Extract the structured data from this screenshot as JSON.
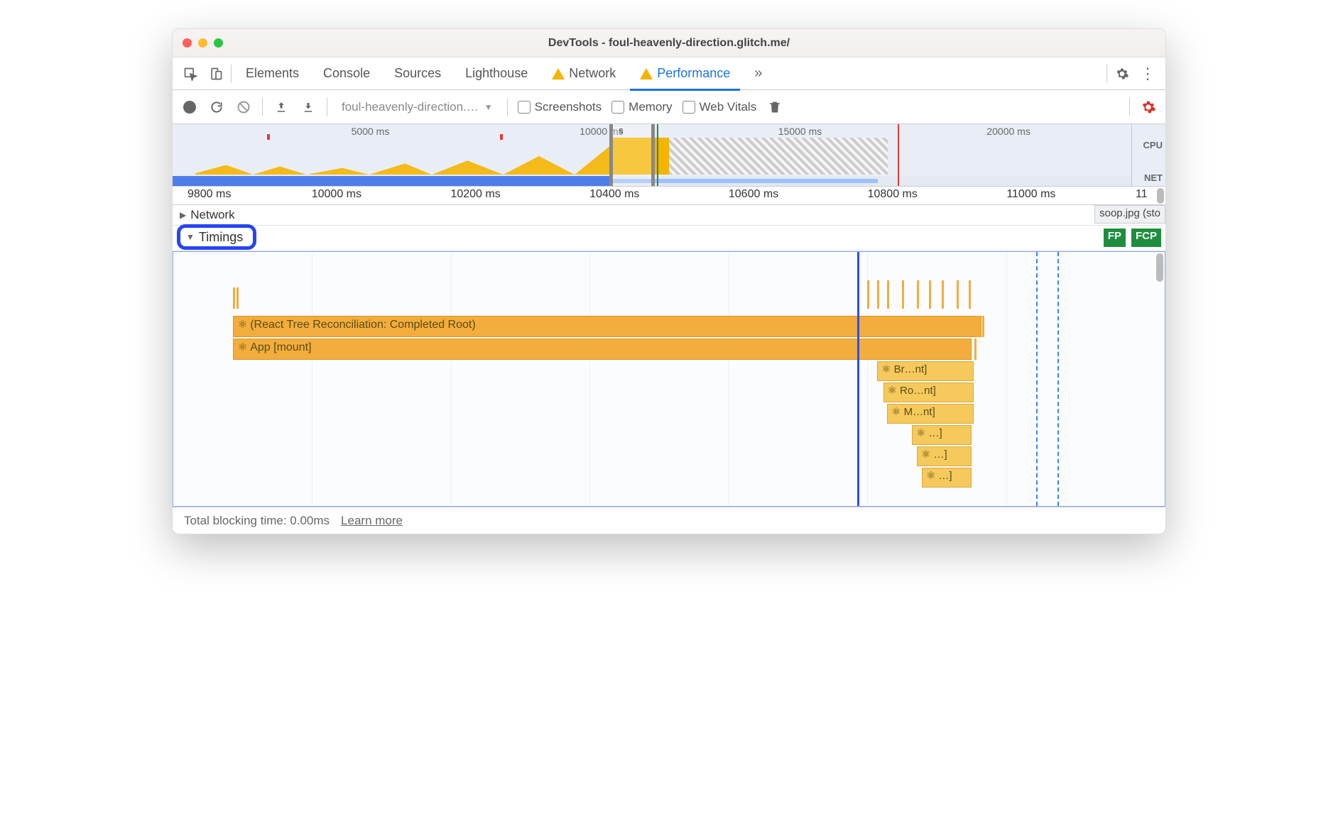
{
  "window": {
    "title": "DevTools - foul-heavenly-direction.glitch.me/"
  },
  "tabs": {
    "items": [
      "Elements",
      "Console",
      "Sources",
      "Lighthouse",
      "Network",
      "Performance"
    ],
    "active_index": 5,
    "warn_indexes": [
      4,
      5
    ]
  },
  "toolbar": {
    "profile_select": "foul-heavenly-direction.…",
    "checks": {
      "screenshots": "Screenshots",
      "memory": "Memory",
      "webvitals": "Web Vitals"
    }
  },
  "overview": {
    "ticks": [
      "5000 ms",
      "10000 ms",
      "15000 ms",
      "20000 ms"
    ],
    "labels": {
      "cpu": "CPU",
      "net": "NET"
    }
  },
  "ruler": {
    "ticks": [
      "9800 ms",
      "10000 ms",
      "10200 ms",
      "10400 ms",
      "10600 ms",
      "10800 ms",
      "11000 ms",
      "11"
    ]
  },
  "tracks": {
    "network": {
      "label": "Network",
      "chip": "soop.jpg (sto"
    },
    "timings": {
      "label": "Timings",
      "fp": "FP",
      "fcp": "FCP",
      "bars": {
        "reconciliation": "(React Tree Reconciliation: Completed Root)",
        "app_mount": "App [mount]",
        "br": "Br…nt]",
        "ro": "Ro…nt]",
        "m": "M…nt]",
        "e1": "…]",
        "e2": "…]",
        "e3": "…]"
      }
    }
  },
  "status": {
    "blocking": "Total blocking time: 0.00ms",
    "learn_more": "Learn more"
  }
}
